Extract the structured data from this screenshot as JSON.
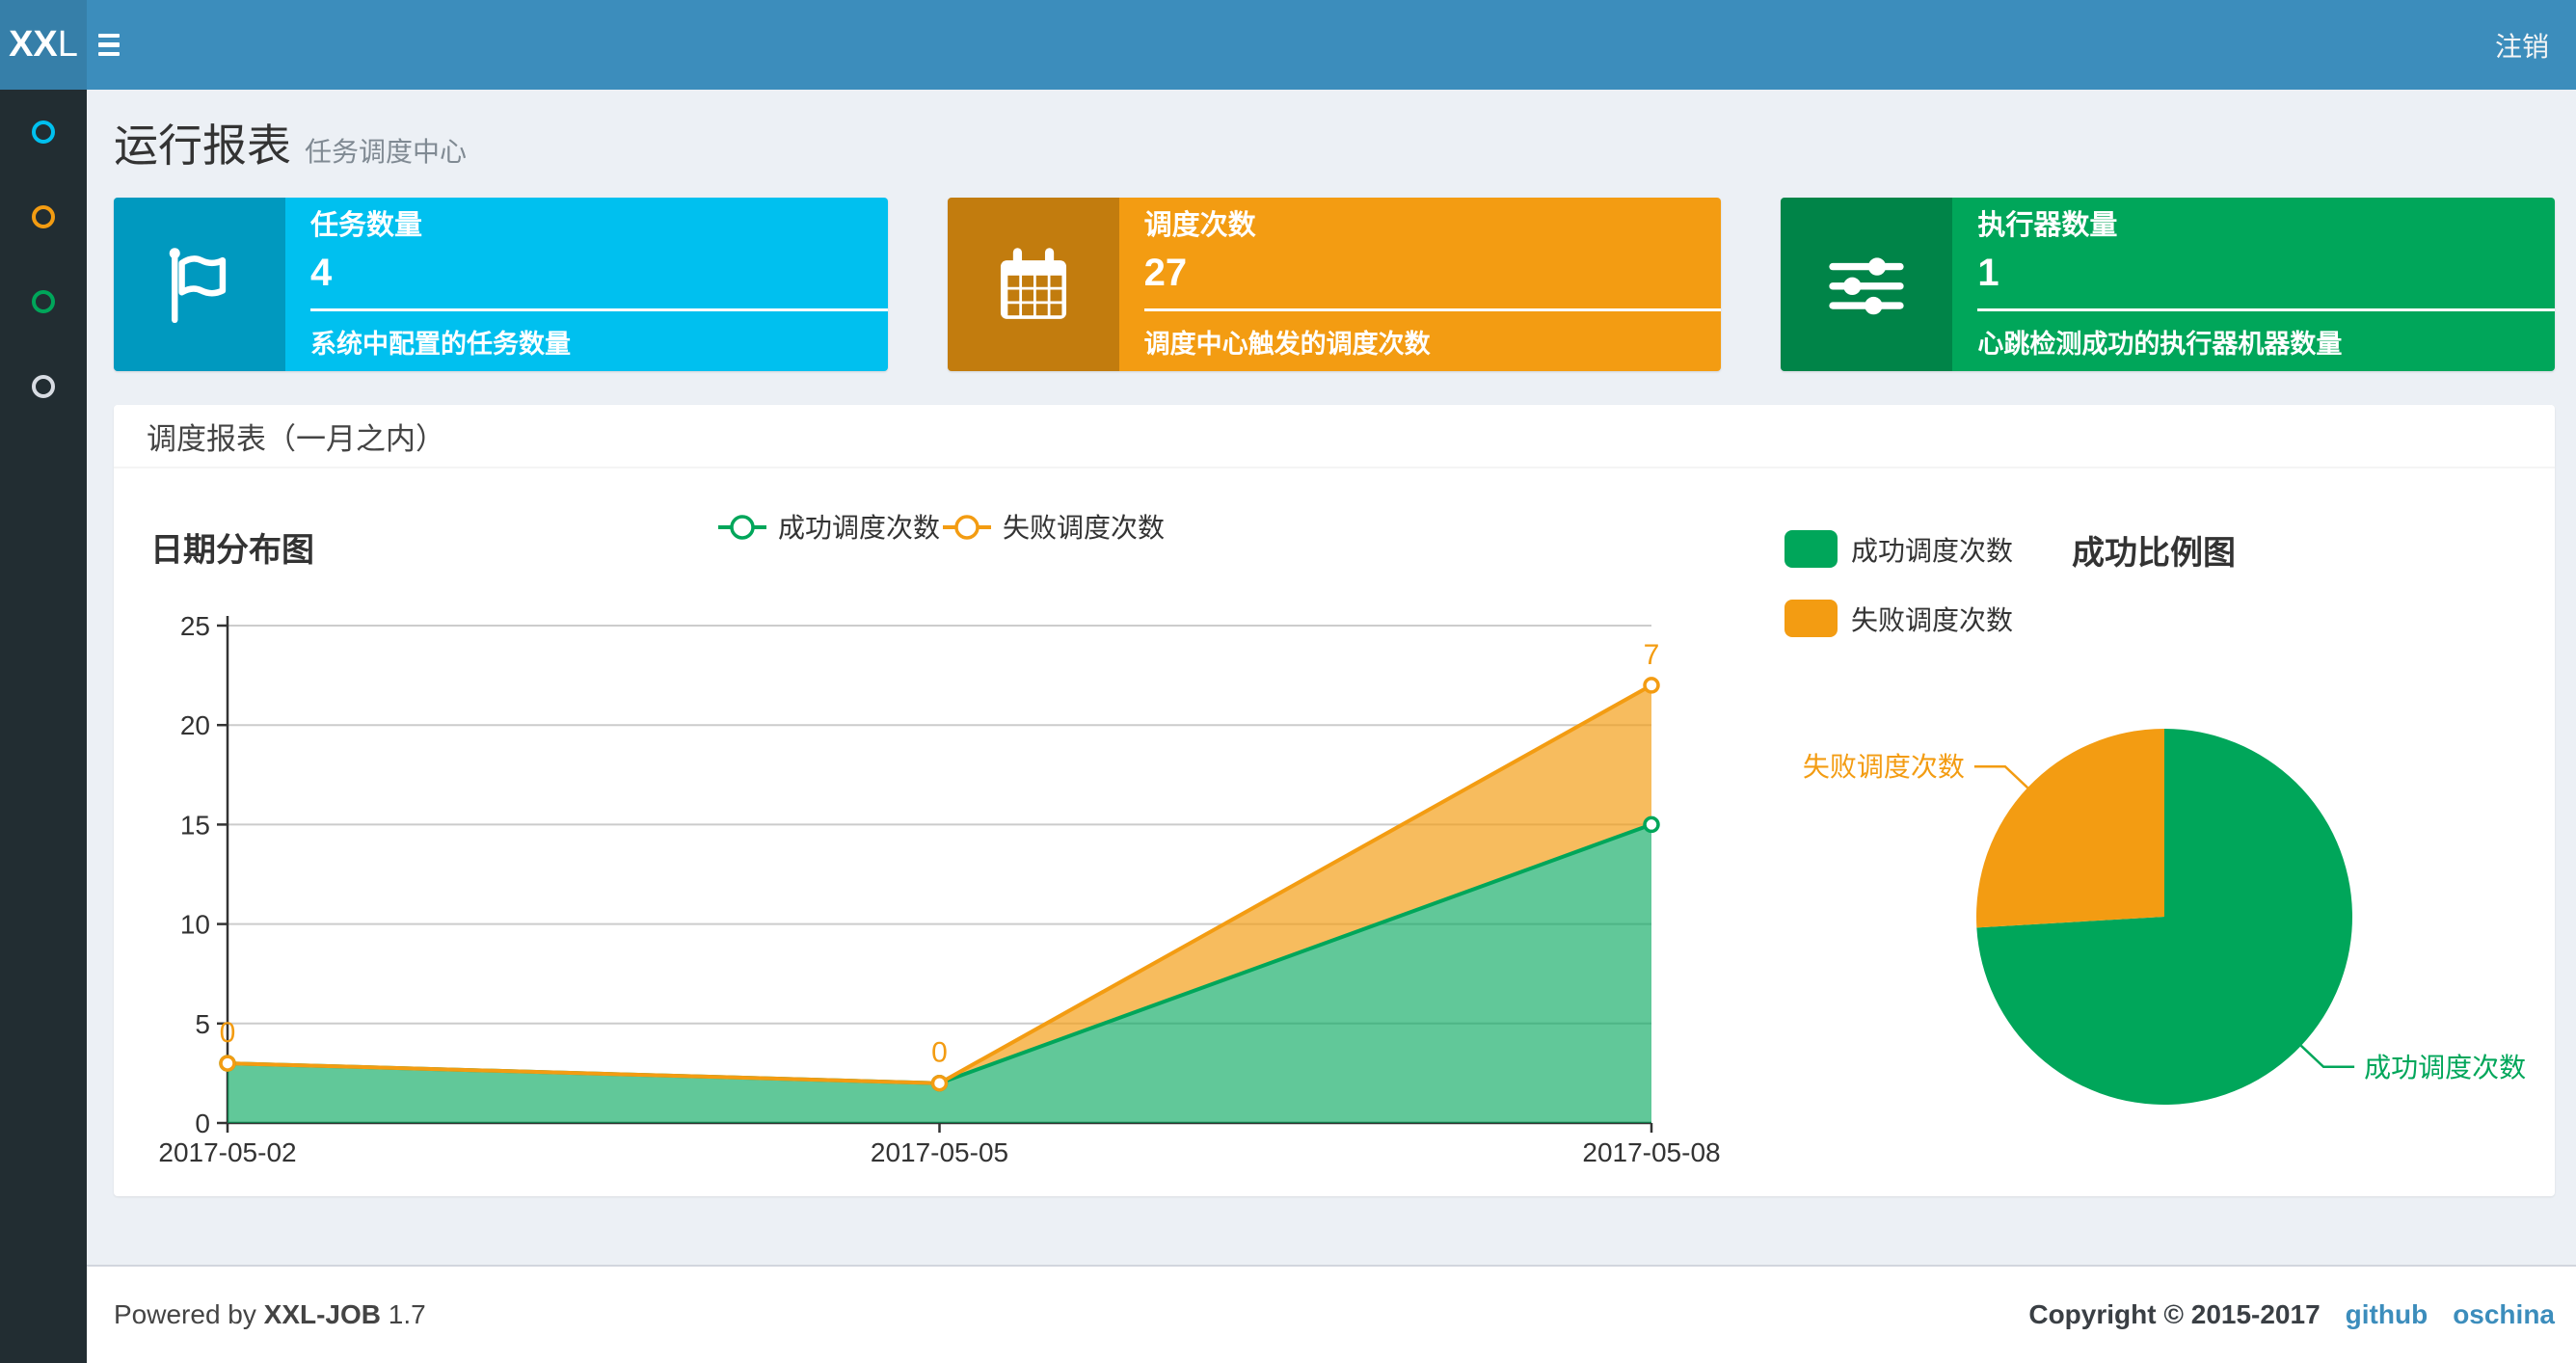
{
  "navbar": {
    "logo_bold": "XX",
    "logo_light": "L",
    "logout_label": "注销"
  },
  "sidebar": {
    "items": [
      {
        "id": "run-report",
        "icon": "circle-icon",
        "color": "#00c0ef"
      },
      {
        "id": "job-manage",
        "icon": "circle-icon",
        "color": "#f39c12"
      },
      {
        "id": "executor-manage",
        "icon": "circle-icon",
        "color": "#00a65a"
      },
      {
        "id": "job-log",
        "icon": "circle-icon",
        "color": "#d8dce3"
      }
    ]
  },
  "page_header": {
    "title": "运行报表",
    "subtitle": "任务调度中心"
  },
  "stat_cards": [
    {
      "label": "任务数量",
      "value": "4",
      "desc": "系统中配置的任务数量",
      "color": "#00c0ef",
      "icon": "flag-icon"
    },
    {
      "label": "调度次数",
      "value": "27",
      "desc": "调度中心触发的调度次数",
      "color": "#f39c12",
      "icon": "calendar-icon"
    },
    {
      "label": "执行器数量",
      "value": "1",
      "desc": "心跳检测成功的执行器机器数量",
      "color": "#00a65a",
      "icon": "sliders-icon"
    }
  ],
  "panel": {
    "title": "调度报表（一月之内）"
  },
  "chart_data": [
    {
      "type": "area",
      "title": "日期分布图",
      "stacked": true,
      "grid": true,
      "legend_position": "top-center",
      "categories": [
        "2017-05-02",
        "2017-05-05",
        "2017-05-08"
      ],
      "series": [
        {
          "name": "成功调度次数",
          "values": [
            3,
            2,
            15
          ],
          "color": "#00a65a"
        },
        {
          "name": "失败调度次数",
          "values": [
            0,
            0,
            7
          ],
          "color": "#f39c12"
        }
      ],
      "ylim": [
        0,
        25
      ],
      "ystep": 5,
      "xlabel": "",
      "ylabel": "",
      "point_label_series": "失败调度次数"
    },
    {
      "type": "pie",
      "title": "成功比例图",
      "legend_position": "top-left",
      "slices": [
        {
          "name": "成功调度次数",
          "value": 20,
          "color": "#00a65a"
        },
        {
          "name": "失败调度次数",
          "value": 7,
          "color": "#f39c12"
        }
      ]
    }
  ],
  "footer": {
    "powered_prefix": "Powered by",
    "brand": "XXL-JOB",
    "version": "1.7",
    "copyright": "Copyright © 2015-2017",
    "links": [
      {
        "label": "github"
      },
      {
        "label": "oschina"
      }
    ],
    "link_color": "#3c8dbc"
  }
}
